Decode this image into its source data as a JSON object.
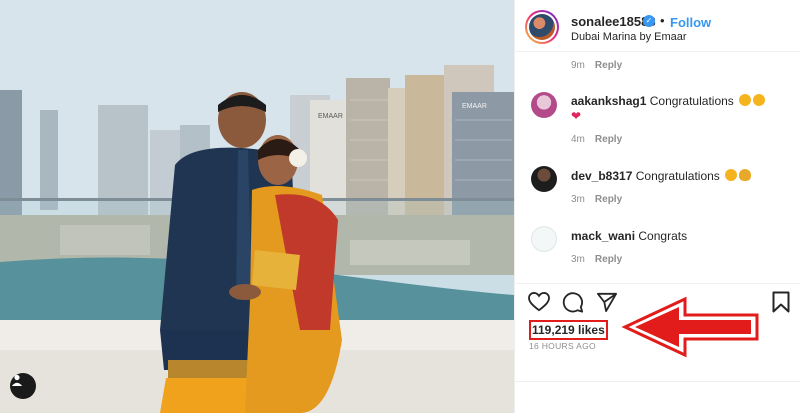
{
  "post": {
    "username": "sonalee18588",
    "follow_label": "Follow",
    "separator": "•",
    "location": "Dubai Marina by Emaar"
  },
  "comments": [
    {
      "username": "",
      "text": "",
      "time": "9m",
      "reply_label": "Reply"
    },
    {
      "username": "aakankshag1",
      "text": "Congratulations",
      "time": "4m",
      "reply_label": "Reply"
    },
    {
      "username": "dev_b8317",
      "text": "Congratulations",
      "time": "3m",
      "reply_label": "Reply"
    },
    {
      "username": "mack_wani",
      "text": "Congrats",
      "time": "3m",
      "reply_label": "Reply"
    }
  ],
  "engagement": {
    "likes": "119,219 likes",
    "posted": "16 HOURS AGO"
  },
  "photo_signage": {
    "left_tower": "EMAAR",
    "right_tower": "EMAAR"
  },
  "icons": {
    "like": "heart-outline-icon",
    "comment": "speech-bubble-icon",
    "share": "paper-plane-icon",
    "save": "bookmark-icon",
    "verified": "verified-check-icon",
    "photo_tags": "user-tag-icon"
  },
  "colors": {
    "link_blue": "#3897f0",
    "annotation_red": "#e21b1b",
    "muted_text": "#8e8e8e"
  }
}
